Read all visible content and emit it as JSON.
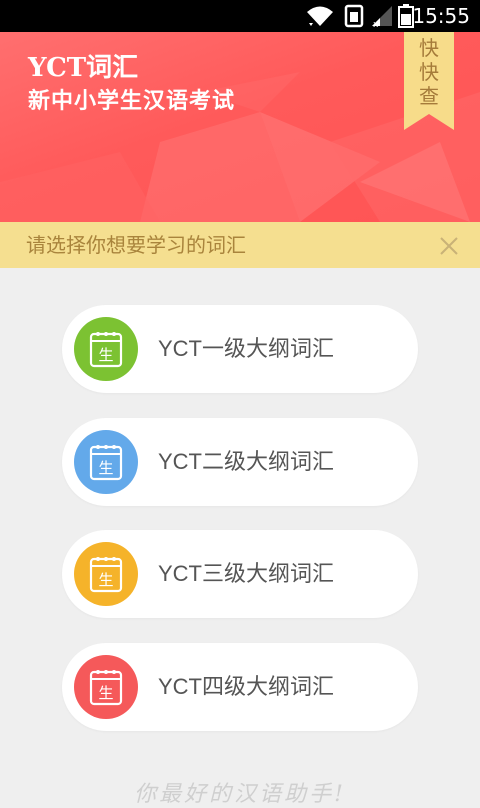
{
  "status_bar": {
    "time": "15:55",
    "icons": [
      "wifi-icon",
      "sim-icon",
      "signal-icon",
      "battery-icon"
    ]
  },
  "header": {
    "title": "YCT词汇",
    "subtitle": "新中小学生汉语考试",
    "quick_lookup": [
      "快",
      "快",
      "查"
    ],
    "background_color": "#ff5a5a",
    "ribbon_color": "#f7dc8a"
  },
  "notice": {
    "text": "请选择你想要学习的词汇",
    "close_icon": "close-icon",
    "background_color": "#f5df90"
  },
  "levels": [
    {
      "label": "YCT一级大纲词汇",
      "icon_text": "生",
      "color": "#7cc232"
    },
    {
      "label": "YCT二级大纲词汇",
      "icon_text": "生",
      "color": "#63a9ea"
    },
    {
      "label": "YCT三级大纲词汇",
      "icon_text": "生",
      "color": "#f5b32a"
    },
    {
      "label": "YCT四级大纲词汇",
      "icon_text": "生",
      "color": "#f5595a"
    }
  ],
  "footer": {
    "slogan": "你最好的汉语助手!"
  }
}
